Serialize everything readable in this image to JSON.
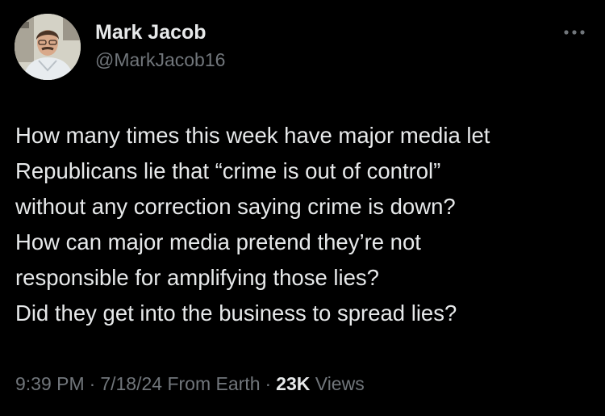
{
  "author": {
    "display_name": "Mark Jacob",
    "handle": "@MarkJacob16"
  },
  "tweet": {
    "lines": [
      "How many times this week have major media let",
      "Republicans lie that “crime is out of control”",
      "without any correction saying crime is down?",
      "How can major media pretend they’re not",
      "responsible for amplifying those lies?",
      "Did they get into the business to spread lies?"
    ]
  },
  "meta": {
    "time": "9:39 PM",
    "date": "7/18/24",
    "source": "From Earth",
    "separator": "·",
    "views_count": "23K",
    "views_label": "Views"
  },
  "icons": {
    "more": "more-horizontal-icon"
  },
  "colors": {
    "background": "#000000",
    "primary_text": "#e7e9ea",
    "secondary_text": "#71767b"
  }
}
